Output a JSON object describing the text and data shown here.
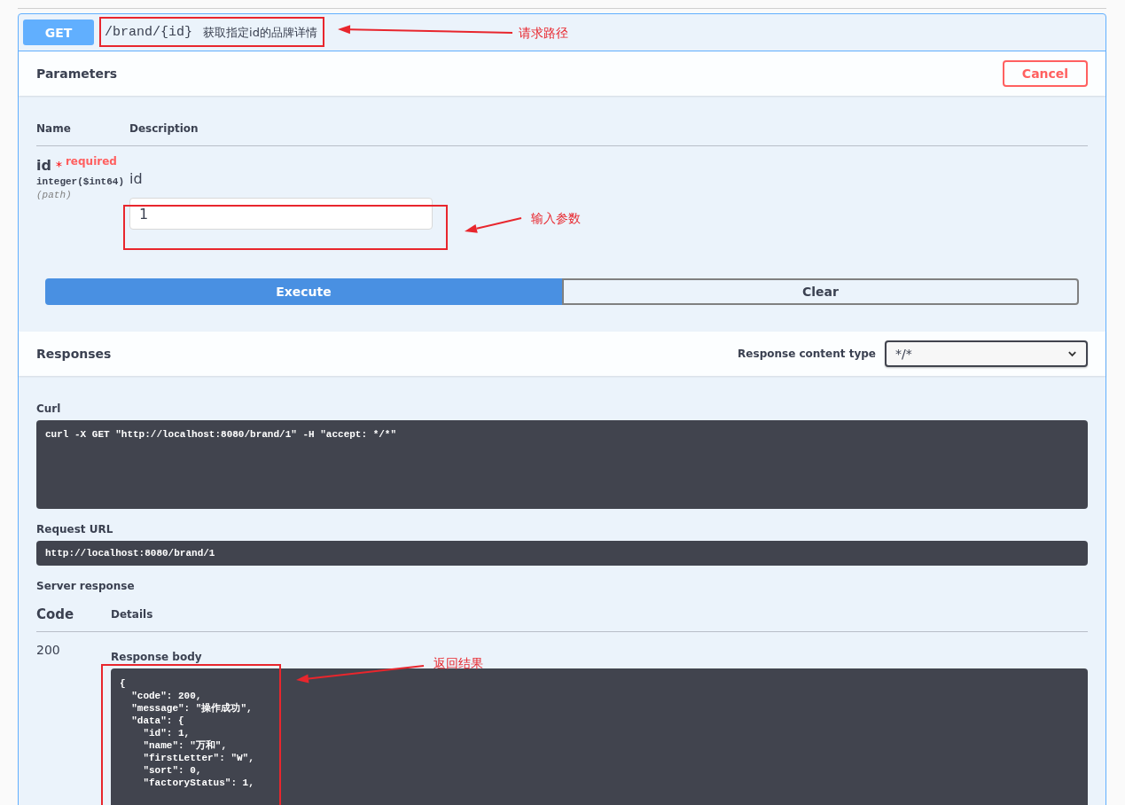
{
  "operation": {
    "method": "GET",
    "path": "/brand/{id}",
    "summary": "获取指定id的品牌详情"
  },
  "parameters": {
    "title": "Parameters",
    "cancel_button": "Cancel",
    "columns": [
      "Name",
      "Description"
    ],
    "items": [
      {
        "name": "id",
        "required_mark": "*",
        "required_label": "required",
        "type": "integer($int64)",
        "location": "(path)",
        "description": "id",
        "value": "1"
      }
    ]
  },
  "actions": [
    {
      "label": "Execute",
      "kind": "primary"
    },
    {
      "label": "Clear",
      "kind": "secondary"
    }
  ],
  "responses": {
    "title": "Responses",
    "content_type_label": "Response content type",
    "content_type": "*/*",
    "curl_label": "Curl",
    "curl": "curl -X GET \"http://localhost:8080/brand/1\" -H \"accept: */*\"",
    "request_url_label": "Request URL",
    "request_url": "http://localhost:8080/brand/1",
    "server_response_label": "Server response",
    "columns": [
      "Code",
      "Details"
    ],
    "code": "200",
    "body_label": "Response body",
    "body_lines": [
      "{",
      "  \"code\": 200,",
      "  \"message\": \"操作成功\",",
      "  \"data\": {",
      "    \"id\": 1,",
      "    \"name\": \"万和\",",
      "    \"firstLetter\": \"W\",",
      "    \"sort\": 0,",
      "    \"factoryStatus\": 1,"
    ]
  },
  "annotations": [
    {
      "label": "请求路径"
    },
    {
      "label": "输入参数"
    },
    {
      "label": "返回结果"
    }
  ]
}
